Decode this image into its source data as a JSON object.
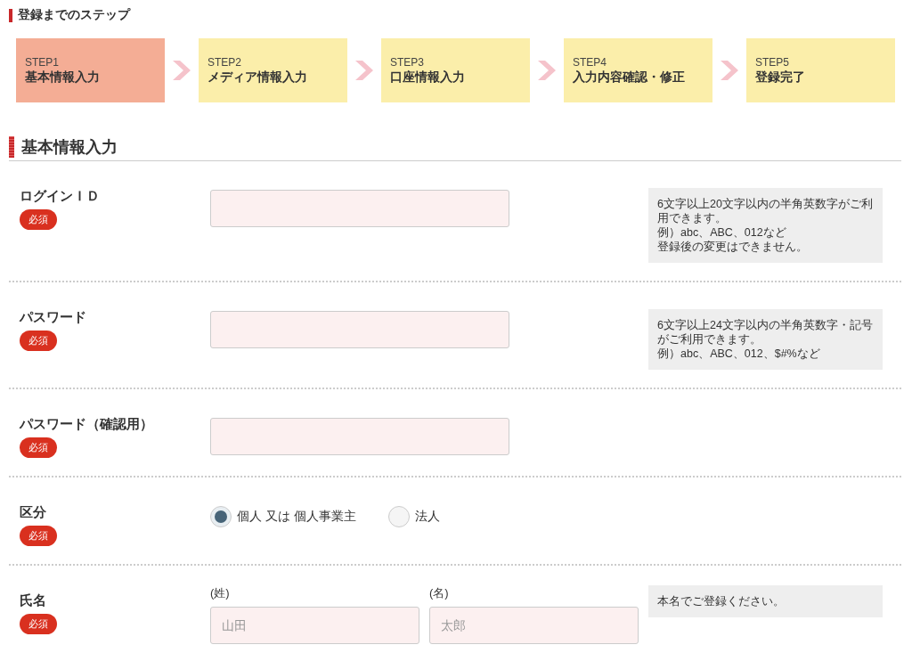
{
  "progress": {
    "title": "登録までのステップ",
    "steps": [
      {
        "label": "STEP1",
        "name": "基本情報入力",
        "selected": true
      },
      {
        "label": "STEP2",
        "name": "メディア情報入力",
        "selected": false
      },
      {
        "label": "STEP3",
        "name": "口座情報入力",
        "selected": false
      },
      {
        "label": "STEP4",
        "name": "入力内容確認・修正",
        "selected": false
      },
      {
        "label": "STEP5",
        "name": "登録完了",
        "selected": false
      }
    ]
  },
  "section": {
    "title": "基本情報入力"
  },
  "rows": [
    {
      "kind": "text",
      "label": "ログインＩＤ",
      "badge": "必須",
      "note": [
        "6文字以上20文字以内の半角英数字がご利用できます。",
        "例）abc、ABC、012など",
        "登録後の変更はできません。"
      ]
    },
    {
      "kind": "text",
      "label": "パスワード",
      "badge": "必須",
      "note": [
        "6文字以上24文字以内の半角英数字・記号がご利用できます。",
        "例）abc、ABC、012、$#%など"
      ]
    },
    {
      "kind": "text",
      "label": "パスワード（確認用）",
      "badge": "必須"
    },
    {
      "kind": "radio",
      "label": "区分",
      "badge": "必須",
      "options": [
        {
          "label": "個人 又は 個人事業主",
          "selected": true
        },
        {
          "label": "法人",
          "selected": false
        }
      ]
    },
    {
      "kind": "name",
      "label": "氏名",
      "badge": "必須",
      "fields": [
        {
          "caption": "(姓)",
          "placeholder": "山田"
        },
        {
          "caption": "(名)",
          "placeholder": "太郎"
        }
      ],
      "note": [
        "本名でご登録ください。"
      ]
    }
  ]
}
